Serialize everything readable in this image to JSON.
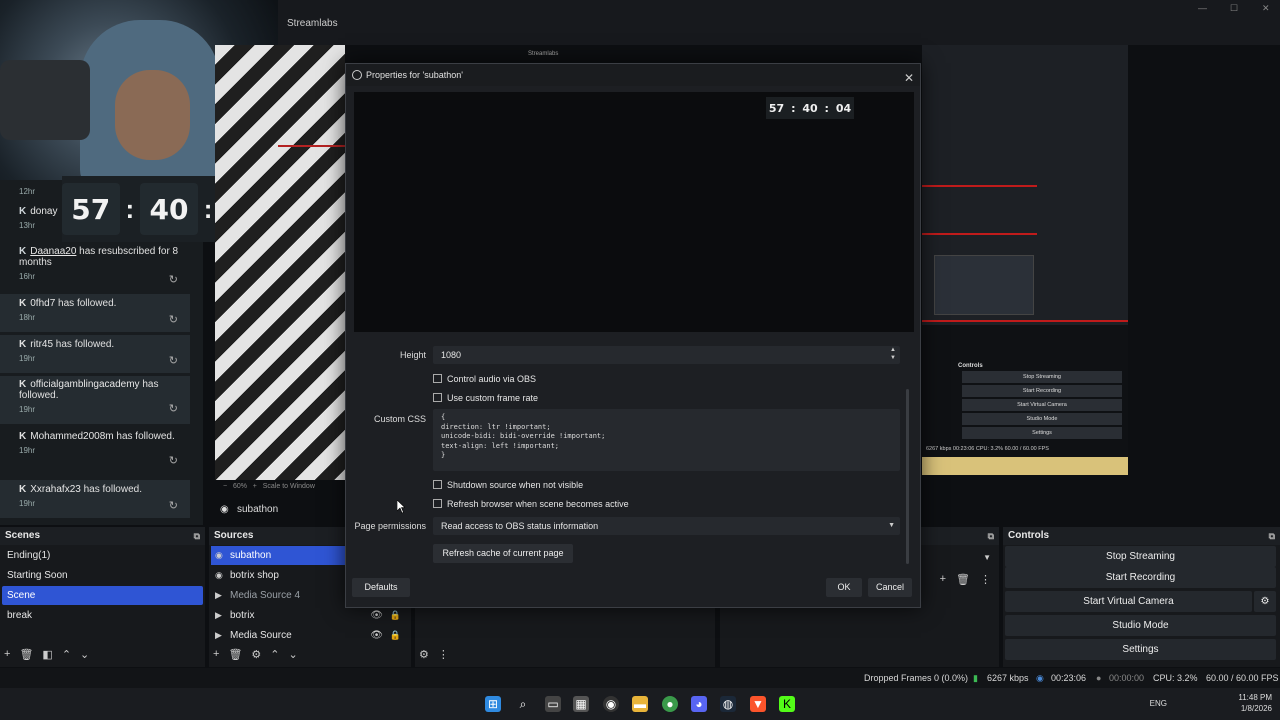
{
  "app": {
    "title": "Streamlabs",
    "inner_title": "Streamlabs"
  },
  "timer": {
    "hours": "57",
    "minutes": "40",
    "seconds": "04",
    "sep": ":"
  },
  "feed": {
    "items": [
      {
        "prefix": "",
        "name": "",
        "text": "",
        "time": "12hr"
      },
      {
        "prefix": "K",
        "name": "donay",
        "text": "",
        "time": "13hr"
      },
      {
        "prefix": "K",
        "name": "Daanaa20",
        "text": " has resubscribed for 8 months",
        "time": "16hr"
      },
      {
        "prefix": "K",
        "name": "0fhd7",
        "text": " has followed.",
        "time": "18hr"
      },
      {
        "prefix": "K",
        "name": "ritr45",
        "text": " has followed.",
        "time": "19hr"
      },
      {
        "prefix": "K",
        "name": "officialgamblingacademy",
        "text": " has followed.",
        "time": "19hr"
      },
      {
        "prefix": "K",
        "name": "Mohammed2008m",
        "text": " has followed.",
        "time": "19hr"
      },
      {
        "prefix": "K",
        "name": "Xxrahafx23",
        "text": " has followed.",
        "time": "19hr"
      }
    ],
    "refresh_icon": "↻"
  },
  "preview": {
    "zoom": "60%",
    "scale": "Scale to Window",
    "source_label": "subathon"
  },
  "dialog": {
    "title": "Properties for 'subathon'",
    "close": "✕",
    "height_label": "Height",
    "height_value": "1080",
    "control_audio": "Control audio via OBS",
    "custom_frame_rate": "Use custom frame rate",
    "custom_css_label": "Custom CSS",
    "custom_css": "{\ndirection: ltr !important;\nunicode-bidi: bidi-override !important;\ntext-align: left !important;\n}",
    "shutdown": "Shutdown source when not visible",
    "refresh_browser": "Refresh browser when scene becomes active",
    "page_permissions_label": "Page permissions",
    "page_permissions_value": "Read access to OBS status information",
    "refresh_cache": "Refresh cache of current page",
    "defaults": "Defaults",
    "ok": "OK",
    "cancel": "Cancel"
  },
  "scenes": {
    "header": "Scenes",
    "items": [
      "Ending(1)",
      "Starting Soon",
      "Scene",
      "break"
    ],
    "active": "Scene"
  },
  "sources": {
    "header": "Sources",
    "items": [
      "subathon",
      "botrix shop",
      "Media Source 4",
      "botrix",
      "Media Source"
    ]
  },
  "controls": {
    "header": "Controls",
    "stop_streaming": "Stop Streaming",
    "start_recording": "Start Recording",
    "start_virtual_camera": "Start Virtual Camera",
    "studio_mode": "Studio Mode",
    "settings": "Settings"
  },
  "nested": {
    "controls_header": "Controls",
    "stop_streaming": "Stop Streaming",
    "start_recording": "Start Recording",
    "start_virtual_camera": "Start Virtual Camera",
    "studio_mode": "Studio Mode",
    "settings": "Settings",
    "status": "6267 kbps   00:23:06   CPU: 3.2%   60.00 / 60.00 FPS"
  },
  "status": {
    "dropped_frames": "Dropped Frames 0 (0.0%)",
    "kbps": "6267 kbps",
    "stream_time": "00:23:06",
    "rec_time": "00:00:00",
    "cpu": "CPU: 3.2%",
    "fps": "60.00 / 60.00 FPS"
  },
  "tray": {
    "lang": "ENG",
    "time": "11:48 PM",
    "date": "1/8/2026"
  },
  "colors": {
    "accent": "#2f55d4",
    "red": "#c01b1b"
  }
}
